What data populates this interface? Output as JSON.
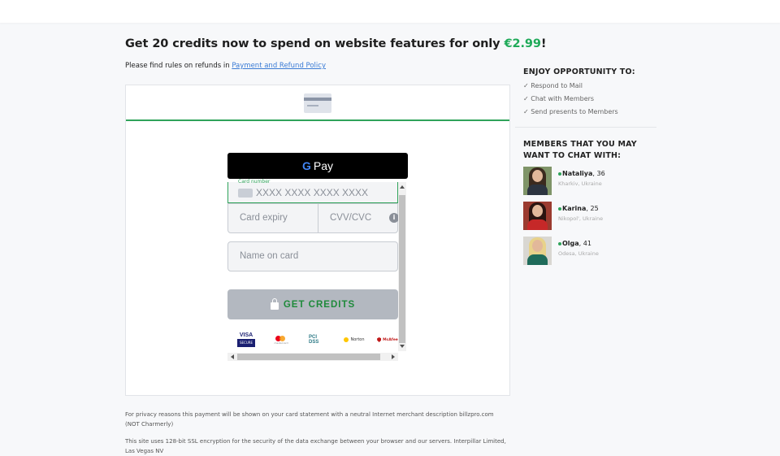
{
  "headline": {
    "text": "Get 20 credits now to spend on website features for only ",
    "price": "€2.99",
    "suffix": "!"
  },
  "refund": {
    "text": "Please find rules on refunds in ",
    "link": "Payment and Refund Policy"
  },
  "payment_form": {
    "gpay_g": "G",
    "gpay_label": "Pay",
    "card_number_label": "Card number",
    "card_number_placeholder": "XXXX XXXX XXXX XXXX",
    "expiry_placeholder": "Card expiry",
    "cvv_placeholder": "CVV/CVC",
    "cvv_info": "i",
    "name_placeholder": "Name on card",
    "submit_label": "GET CREDITS",
    "logos": {
      "visa": "VISA",
      "visa_sub": "SECURE",
      "mastercard": "mastercard",
      "pci": "PCI DSS",
      "norton": "Norton",
      "mcafee": "McAfee"
    }
  },
  "footnotes": {
    "privacy": "For privacy reasons this payment will be shown on your card statement with a neutral Internet merchant description billzpro.com (NOT Charmerly)",
    "ssl": "This site uses 128-bit SSL encryption for the security of the data exchange between your browser and our servers. Interpillar Limited, Las Vegas NV"
  },
  "sidebar": {
    "opportunity_title": "ENJOY OPPORTUNITY TO:",
    "opportunities": [
      "✓ Respond to Mail",
      "✓ Chat with Members",
      "✓ Send presents to Members"
    ],
    "members_title": "MEMBERS THAT YOU MAY WANT TO CHAT WITH:",
    "members": [
      {
        "name": "Nataliya",
        "age": ", 36",
        "location": "Kharkiv, Ukraine"
      },
      {
        "name": "Karina",
        "age": ", 25",
        "location": "Nikopol', Ukraine"
      },
      {
        "name": "Olga",
        "age": ", 41",
        "location": "Odesa, Ukraine"
      }
    ]
  },
  "colors": {
    "accent_green": "#2fa35a",
    "price_green": "#1faa59",
    "link_blue": "#3a7bd5",
    "button_gray": "#b3b8c0"
  }
}
